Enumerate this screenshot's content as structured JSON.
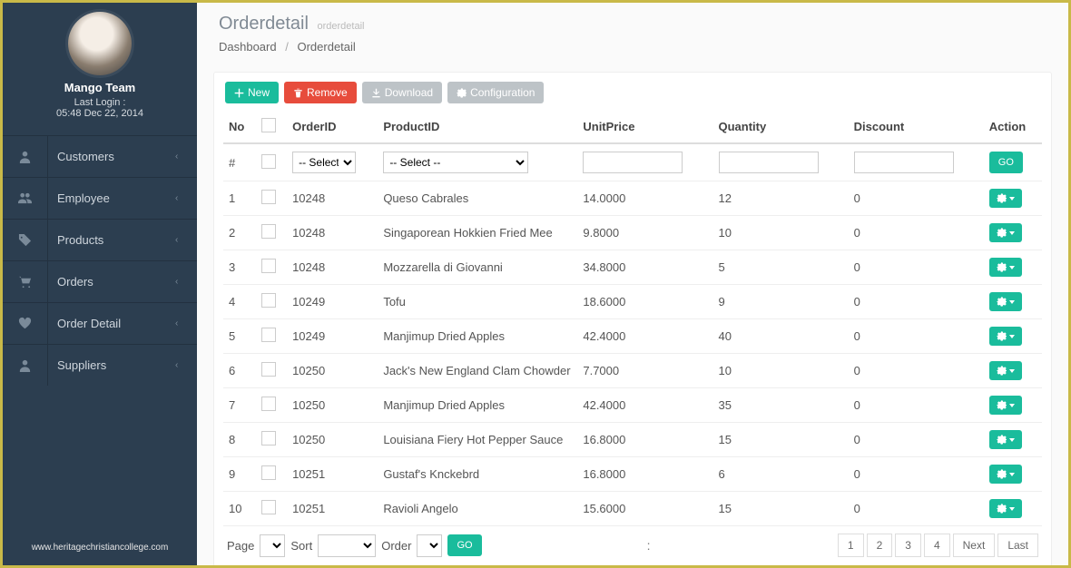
{
  "profile": {
    "name": "Mango Team",
    "last_login_label": "Last Login :",
    "last_login": "05:48 Dec 22, 2014"
  },
  "nav": [
    {
      "icon": "user",
      "label": "Customers"
    },
    {
      "icon": "users",
      "label": "Employee"
    },
    {
      "icon": "tag",
      "label": "Products"
    },
    {
      "icon": "cart",
      "label": "Orders"
    },
    {
      "icon": "heart",
      "label": "Order Detail"
    },
    {
      "icon": "user",
      "label": "Suppliers"
    }
  ],
  "footer": "www.heritagechristiancollege.com",
  "header": {
    "title": "Orderdetail",
    "subtitle": "orderdetail"
  },
  "breadcrumb": [
    "Dashboard",
    "Orderdetail"
  ],
  "toolbar": {
    "new": "New",
    "remove": "Remove",
    "download": "Download",
    "config": "Configuration"
  },
  "columns": [
    "No",
    "",
    "OrderID",
    "ProductID",
    "UnitPrice",
    "Quantity",
    "Discount",
    "Action"
  ],
  "filters": {
    "hash": "#",
    "select": "-- Select --",
    "go": "GO"
  },
  "rows": [
    {
      "no": "1",
      "orderid": "10248",
      "product": "Queso Cabrales",
      "price": "14.0000",
      "qty": "12",
      "disc": "0"
    },
    {
      "no": "2",
      "orderid": "10248",
      "product": "Singaporean Hokkien Fried Mee",
      "price": "9.8000",
      "qty": "10",
      "disc": "0"
    },
    {
      "no": "3",
      "orderid": "10248",
      "product": "Mozzarella di Giovanni",
      "price": "34.8000",
      "qty": "5",
      "disc": "0"
    },
    {
      "no": "4",
      "orderid": "10249",
      "product": "Tofu",
      "price": "18.6000",
      "qty": "9",
      "disc": "0"
    },
    {
      "no": "5",
      "orderid": "10249",
      "product": "Manjimup Dried Apples",
      "price": "42.4000",
      "qty": "40",
      "disc": "0"
    },
    {
      "no": "6",
      "orderid": "10250",
      "product": "Jack's New England Clam Chowder",
      "price": "7.7000",
      "qty": "10",
      "disc": "0"
    },
    {
      "no": "7",
      "orderid": "10250",
      "product": "Manjimup Dried Apples",
      "price": "42.4000",
      "qty": "35",
      "disc": "0"
    },
    {
      "no": "8",
      "orderid": "10250",
      "product": "Louisiana Fiery Hot Pepper Sauce",
      "price": "16.8000",
      "qty": "15",
      "disc": "0"
    },
    {
      "no": "9",
      "orderid": "10251",
      "product": "Gustaf's Knckebrd",
      "price": "16.8000",
      "qty": "6",
      "disc": "0"
    },
    {
      "no": "10",
      "orderid": "10251",
      "product": "Ravioli Angelo",
      "price": "15.6000",
      "qty": "15",
      "disc": "0"
    }
  ],
  "pager": {
    "page": "Page",
    "sort": "Sort",
    "order": "Order",
    "go": "GO"
  },
  "pagination": [
    "1",
    "2",
    "3",
    "4",
    "Next",
    "Last"
  ]
}
